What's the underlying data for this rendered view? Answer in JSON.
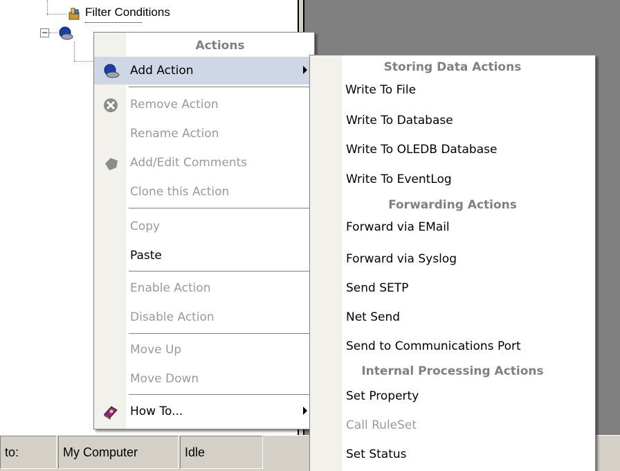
{
  "tree": {
    "filter_conditions": "Filter Conditions",
    "expand_symbol": "−"
  },
  "status_bar": {
    "cell1": "to:",
    "cell2": "My Computer",
    "cell3": "Idle"
  },
  "context_menu": {
    "header": "Actions",
    "items": {
      "add_action": "Add Action",
      "remove_action": "Remove Action",
      "rename_action": "Rename Action",
      "add_edit_comments": "Add/Edit Comments",
      "clone_action": "Clone this Action",
      "copy": "Copy",
      "paste": "Paste",
      "enable_action": "Enable Action",
      "disable_action": "Disable Action",
      "move_up": "Move Up",
      "move_down": "Move Down",
      "how_to": "How To..."
    }
  },
  "submenu": {
    "storing_header": "Storing Data Actions",
    "write_to_file": "Write To File",
    "write_to_database": "Write To Database",
    "write_to_oledb": "Write To OLEDB Database",
    "write_to_eventlog": "Write To EventLog",
    "forwarding_header": "Forwarding Actions",
    "forward_email": "Forward via EMail",
    "forward_syslog": "Forward via Syslog",
    "send_setp": "Send SETP",
    "net_send": "Net Send",
    "send_comm_port": "Send to Communications Port",
    "internal_header": "Internal Processing Actions",
    "set_property": "Set Property",
    "call_ruleset": "Call RuleSet",
    "set_status": "Set Status"
  },
  "colors": {
    "highlight": "#cfd6e5",
    "selected_border": "#7a8bb0",
    "disabled_text": "#9a9a9a",
    "header_text": "#808080"
  }
}
